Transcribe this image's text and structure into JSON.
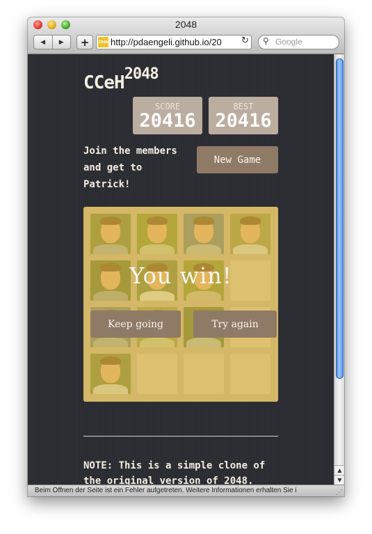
{
  "window": {
    "title": "2048",
    "url": "http://pdaengeli.github.io/20",
    "favicon_text": "2048",
    "search_placeholder": "Google",
    "back_icon": "back-arrow-icon",
    "forward_icon": "forward-arrow-icon",
    "add_icon": "plus-icon",
    "reload_icon": "reload-icon",
    "search_icon": "search-icon"
  },
  "game": {
    "title": "CCeH",
    "title_super": "2048",
    "score_label": "SCORE",
    "score_value": "20416",
    "best_label": "BEST",
    "best_value": "20416",
    "intro": "Join the members and get to Patrick!",
    "new_game_label": "New Game",
    "win_message": "You win!",
    "keep_going_label": "Keep going",
    "try_again_label": "Try again",
    "note": "NOTE: This is a simple clone of the original version of 2048."
  },
  "board": {
    "rows": [
      [
        "photo",
        "photo",
        "photo",
        "photo"
      ],
      [
        "photo",
        "photo",
        "photo",
        "empty"
      ],
      [
        "photo",
        "photo",
        "photo",
        "empty"
      ],
      [
        "photo",
        "empty",
        "empty",
        "empty"
      ]
    ]
  },
  "status": {
    "text": "Beim Öffnen der Seite ist ein Fehler aufgetreten. Weitere Informationen erhalten Sie i"
  },
  "colors": {
    "page_bg": "#2b2c31",
    "board_bg": "#bbada0",
    "button_bg": "#8f7a66",
    "win_overlay": "#edc22e"
  }
}
